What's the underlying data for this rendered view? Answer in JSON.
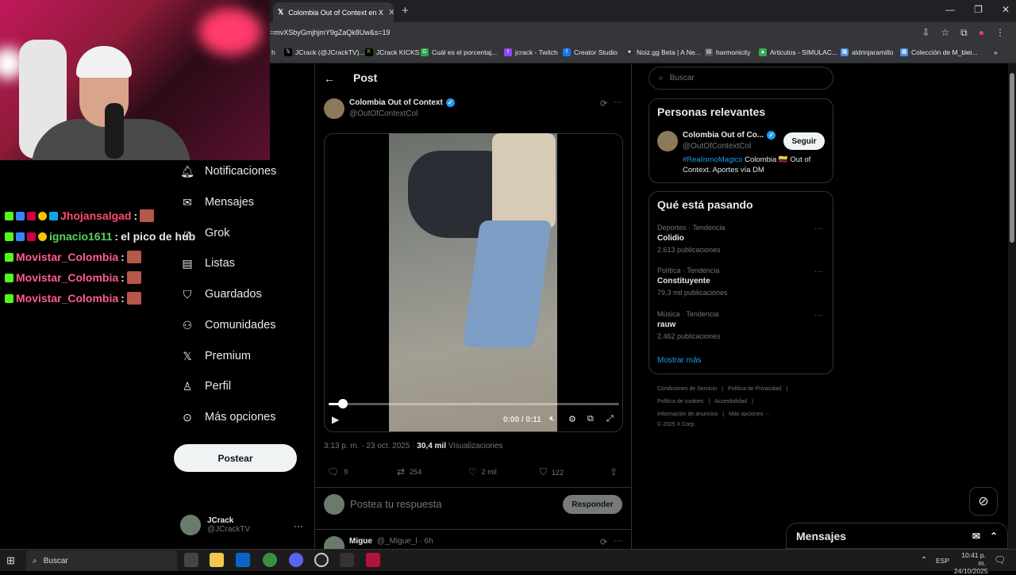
{
  "browser": {
    "tab_title": "Colombia Out of Context en X",
    "url": "=mvXSbyGmjhjmY9gZaQk8Uw&s=19",
    "bookmarks": [
      "h",
      "JCrack (@JCrackTV)...",
      "JCrack KICKS",
      "Cuál es el porcentaj...",
      "jcrack - Twitch",
      "Creator Studio",
      "Noiz.gg Beta | A Ne...",
      "harmonicity",
      "Articulos - SIMULAC...",
      "aldrinjaramillo",
      "Colección de M_blei..."
    ]
  },
  "chat": [
    {
      "user": "Jhojansalgad",
      "color": "#ff4d6d",
      "msg": "",
      "emote": true
    },
    {
      "user": "ignacio1611",
      "color": "#57d65a",
      "msg": " el pico de hub",
      "emote": false
    },
    {
      "user": "Movistar_Colombia",
      "color": "#ff5c8a",
      "msg": "",
      "emote": true
    },
    {
      "user": "Movistar_Colombia",
      "color": "#ff5c8a",
      "msg": "",
      "emote": true
    },
    {
      "user": "Movistar_Colombia",
      "color": "#ff5c8a",
      "msg": "",
      "emote": true
    }
  ],
  "nav": {
    "items": [
      "Notificaciones",
      "Mensajes",
      "Grok",
      "Listas",
      "Guardados",
      "Comunidades",
      "Premium",
      "Perfil",
      "Más opciones"
    ],
    "post_button": "Postear",
    "account_name": "JCrack",
    "account_handle": "@JCrackTV"
  },
  "post": {
    "header": "Post",
    "author_name": "Colombia Out of Context",
    "author_handle": "@OutOfContextCol",
    "video_time": "0:00 / 0:11",
    "progress": 0.05,
    "timestamp": "3:13 p. m. · 23 oct. 2025 · ",
    "views_count": "30,4 mil",
    "views_label": " Visualizaciones",
    "replies": "9",
    "reposts": "254",
    "likes": "2 mil",
    "bookmarks": "122",
    "reply_placeholder": "Postea tu respuesta",
    "reply_button": "Responder",
    "next_reply_name": "Migue",
    "next_reply_handle": "@_Migue_l · 6h"
  },
  "sidebar": {
    "search_placeholder": "Buscar",
    "relevant_title": "Personas relevantes",
    "relevant_name": "Colombia Out of Co...",
    "relevant_handle": "@OutOfContextCol",
    "follow_label": "Seguir",
    "bio_tag": "#RealismoMagico",
    "bio_text": " Colombia 🇨🇴 Out of Context. Aportes vía DM",
    "trending_title": "Qué está pasando",
    "trends": [
      {
        "context": "Deportes · Tendencia",
        "name": "Colidio",
        "count": "2.613 publicaciones"
      },
      {
        "context": "Política · Tendencia",
        "name": "Constituyente",
        "count": "79,3 mil publicaciones"
      },
      {
        "context": "Música · Tendencia",
        "name": "rauw",
        "count": "2.462 publicaciones"
      }
    ],
    "show_more": "Mostrar más",
    "footer_1": "Condiciones de Servicio",
    "footer_2": "Política de Privacidad",
    "footer_3": "Política de cookies",
    "footer_4": "Accesibilidad",
    "footer_5": "Información de anuncios",
    "footer_6": "Más opciones ···",
    "footer_7": "© 2025 X Corp."
  },
  "messages_drawer": "Mensajes",
  "taskbar": {
    "search": "Buscar",
    "lang": "ESP",
    "time": "10:41 p. m.",
    "date": "24/10/2025"
  },
  "colors": {
    "accent": "#1d9bf0",
    "background": "#000000",
    "border": "#2f3336"
  }
}
